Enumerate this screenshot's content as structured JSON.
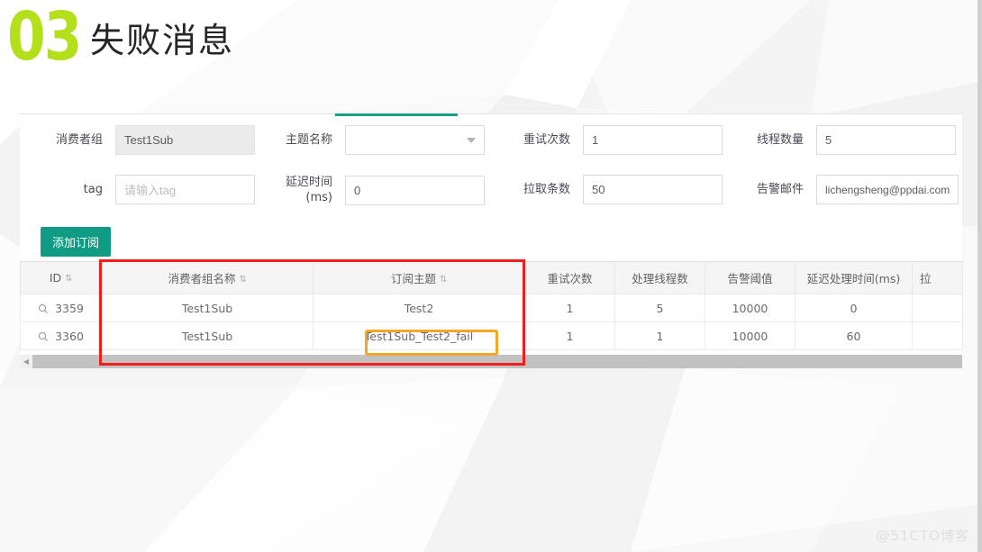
{
  "header": {
    "number": "03",
    "title": "失败消息"
  },
  "form": {
    "fields": [
      {
        "label": "消费者组",
        "value": "Test1Sub",
        "placeholder": "",
        "type": "text-disabled"
      },
      {
        "label": "主题名称",
        "value": "",
        "placeholder": "",
        "type": "select"
      },
      {
        "label": "重试次数",
        "value": "1",
        "placeholder": "",
        "type": "text"
      },
      {
        "label": "线程数量",
        "value": "5",
        "placeholder": "",
        "type": "text"
      },
      {
        "label": "tag",
        "value": "",
        "placeholder": "请输入tag",
        "type": "text"
      },
      {
        "label": "延迟时间",
        "label2": "(ms)",
        "value": "0",
        "placeholder": "",
        "type": "text"
      },
      {
        "label": "拉取条数",
        "value": "50",
        "placeholder": "",
        "type": "text"
      },
      {
        "label": "告警邮件",
        "value": "lichengsheng@ppdai.com",
        "placeholder": "",
        "type": "text"
      }
    ]
  },
  "toolbar": {
    "add_label": "添加订阅"
  },
  "table": {
    "columns": [
      {
        "label": "ID",
        "sortable": true
      },
      {
        "label": "消费者组名称",
        "sortable": true
      },
      {
        "label": "订阅主题",
        "sortable": true
      },
      {
        "label": "重试次数",
        "sortable": false
      },
      {
        "label": "处理线程数",
        "sortable": false
      },
      {
        "label": "告警阈值",
        "sortable": false
      },
      {
        "label": "延迟处理时间(ms)",
        "sortable": false
      },
      {
        "label": "拉",
        "sortable": false
      }
    ],
    "sort_glyph": "⇅",
    "rows": [
      {
        "id": "3359",
        "group": "Test1Sub",
        "topic": "Test2",
        "retry": "1",
        "threads": "5",
        "threshold": "10000",
        "delay": "0",
        "extra": ""
      },
      {
        "id": "3360",
        "group": "Test1Sub",
        "topic": "Test1Sub_Test2_fail",
        "retry": "1",
        "threads": "1",
        "threshold": "10000",
        "delay": "60",
        "extra": ""
      }
    ],
    "scroll_left_arrow": "◀"
  },
  "watermark": "@51CTO博客",
  "colors": {
    "accent_green": "#b4df1b",
    "teal": "#0f9b84",
    "annotation_red": "#ef1d1d",
    "annotation_orange": "#f5a623"
  }
}
